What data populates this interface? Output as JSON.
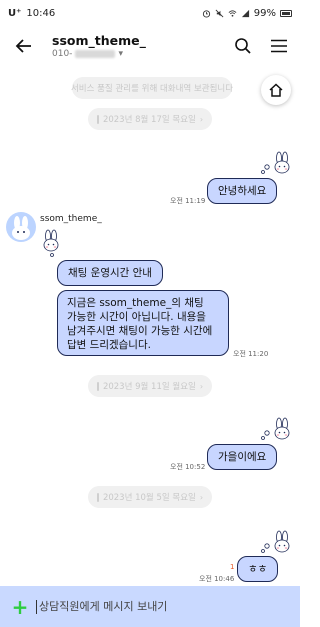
{
  "statusbar": {
    "carrier": "U⁺",
    "time": "10:46",
    "battery": "99%"
  },
  "header": {
    "title": "ssom_theme_",
    "subtitle": "010-",
    "back_icon": "back-arrow-icon",
    "search_icon": "search-icon",
    "menu_icon": "hamburger-menu-icon"
  },
  "home_button": {
    "icon": "home-icon"
  },
  "chat": {
    "notice": "서비스 품질 관리를 위해 대화내역 보관됩니다",
    "dates": [
      "2023년 8월 17일 목요일",
      "2023년 9월 11일 월요일",
      "2023년 10월 5일 목요일"
    ],
    "msg1": {
      "text": "안녕하세요",
      "time": "오전 11:19"
    },
    "sender": {
      "name": "ssom_theme_"
    },
    "msg2": {
      "text": "채팅 운영시간 안내"
    },
    "msg3": {
      "lines": [
        "지금은 ssom_theme_의 채팅",
        "가능한 시간이 아닙니다. 내용을",
        "남겨주시면 채팅이 가능한 시간에",
        "답변 드리겠습니다."
      ],
      "time": "오전 11:20"
    },
    "msg4": {
      "text": "가을이에요",
      "time": "오전 10:52"
    },
    "msg5": {
      "text": "ㅎㅎ",
      "time": "오전 10:46",
      "unread": "1"
    }
  },
  "composer": {
    "placeholder": "상담직원에게 메시지 보내기",
    "plus_icon": "plus-icon"
  },
  "colors": {
    "bubble": "#c8d6ff",
    "bubble_border": "#1f2a56",
    "composer": "#c9d9ff",
    "plus": "#2ecc40"
  }
}
